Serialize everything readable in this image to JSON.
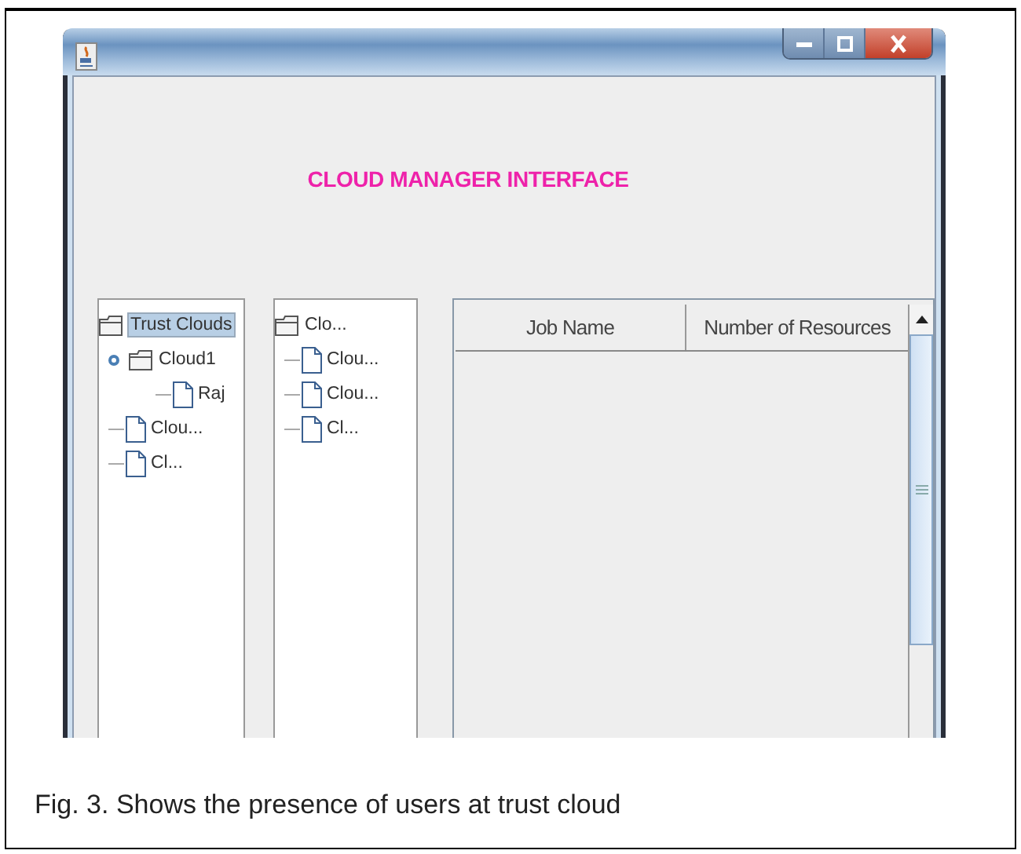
{
  "window": {
    "heading": "CLOUD MANAGER INTERFACE"
  },
  "trees": [
    {
      "nodes": [
        {
          "label": "Trust Clouds",
          "kind": "folder",
          "selected": true,
          "children": [
            {
              "label": "Cloud1",
              "kind": "folder",
              "selected": false,
              "expanded": true,
              "children": [
                {
                  "label": "Raj",
                  "kind": "leaf",
                  "selected": false
                }
              ]
            },
            {
              "label": "Clou...",
              "kind": "leaf",
              "selected": false
            },
            {
              "label": "Cl...",
              "kind": "leaf",
              "selected": false
            }
          ]
        }
      ]
    },
    {
      "nodes": [
        {
          "label": "Clo...",
          "kind": "folder",
          "selected": false,
          "children": [
            {
              "label": "Clou...",
              "kind": "leaf",
              "selected": false
            },
            {
              "label": "Clou...",
              "kind": "leaf",
              "selected": false
            },
            {
              "label": "Cl...",
              "kind": "leaf",
              "selected": false
            }
          ]
        }
      ]
    }
  ],
  "table": {
    "columns": [
      "Job Name",
      "Number of Resources"
    ]
  },
  "caption": "Fig. 3. Shows the presence of users at trust cloud"
}
